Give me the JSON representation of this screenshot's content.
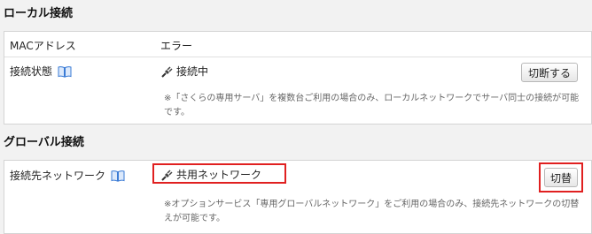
{
  "local": {
    "title": "ローカル接続",
    "mac_label": "MACアドレス",
    "mac_value": "エラー",
    "status_label": "接続状態",
    "status_value": "接続中",
    "disconnect_label": "切断する",
    "note_line1": "※「さくらの専用サーバ」を複数台ご利用の場合のみ、ローカルネットワークでサーバ同士の接続が可能",
    "note_line2": "です。"
  },
  "global": {
    "title": "グローバル接続",
    "network_label": "接続先ネットワーク",
    "network_value": "共用ネットワーク",
    "switch_label": "切替",
    "note_line1": "※オプションサービス「専用グローバルネットワーク」をご利用の場合のみ、接続先ネットワークの切替",
    "note_line2": "えが可能です。"
  },
  "colors": {
    "highlight": "#e02020",
    "book_icon": "#3a7bd5"
  },
  "icons": [
    "book-icon",
    "plug-icon"
  ]
}
